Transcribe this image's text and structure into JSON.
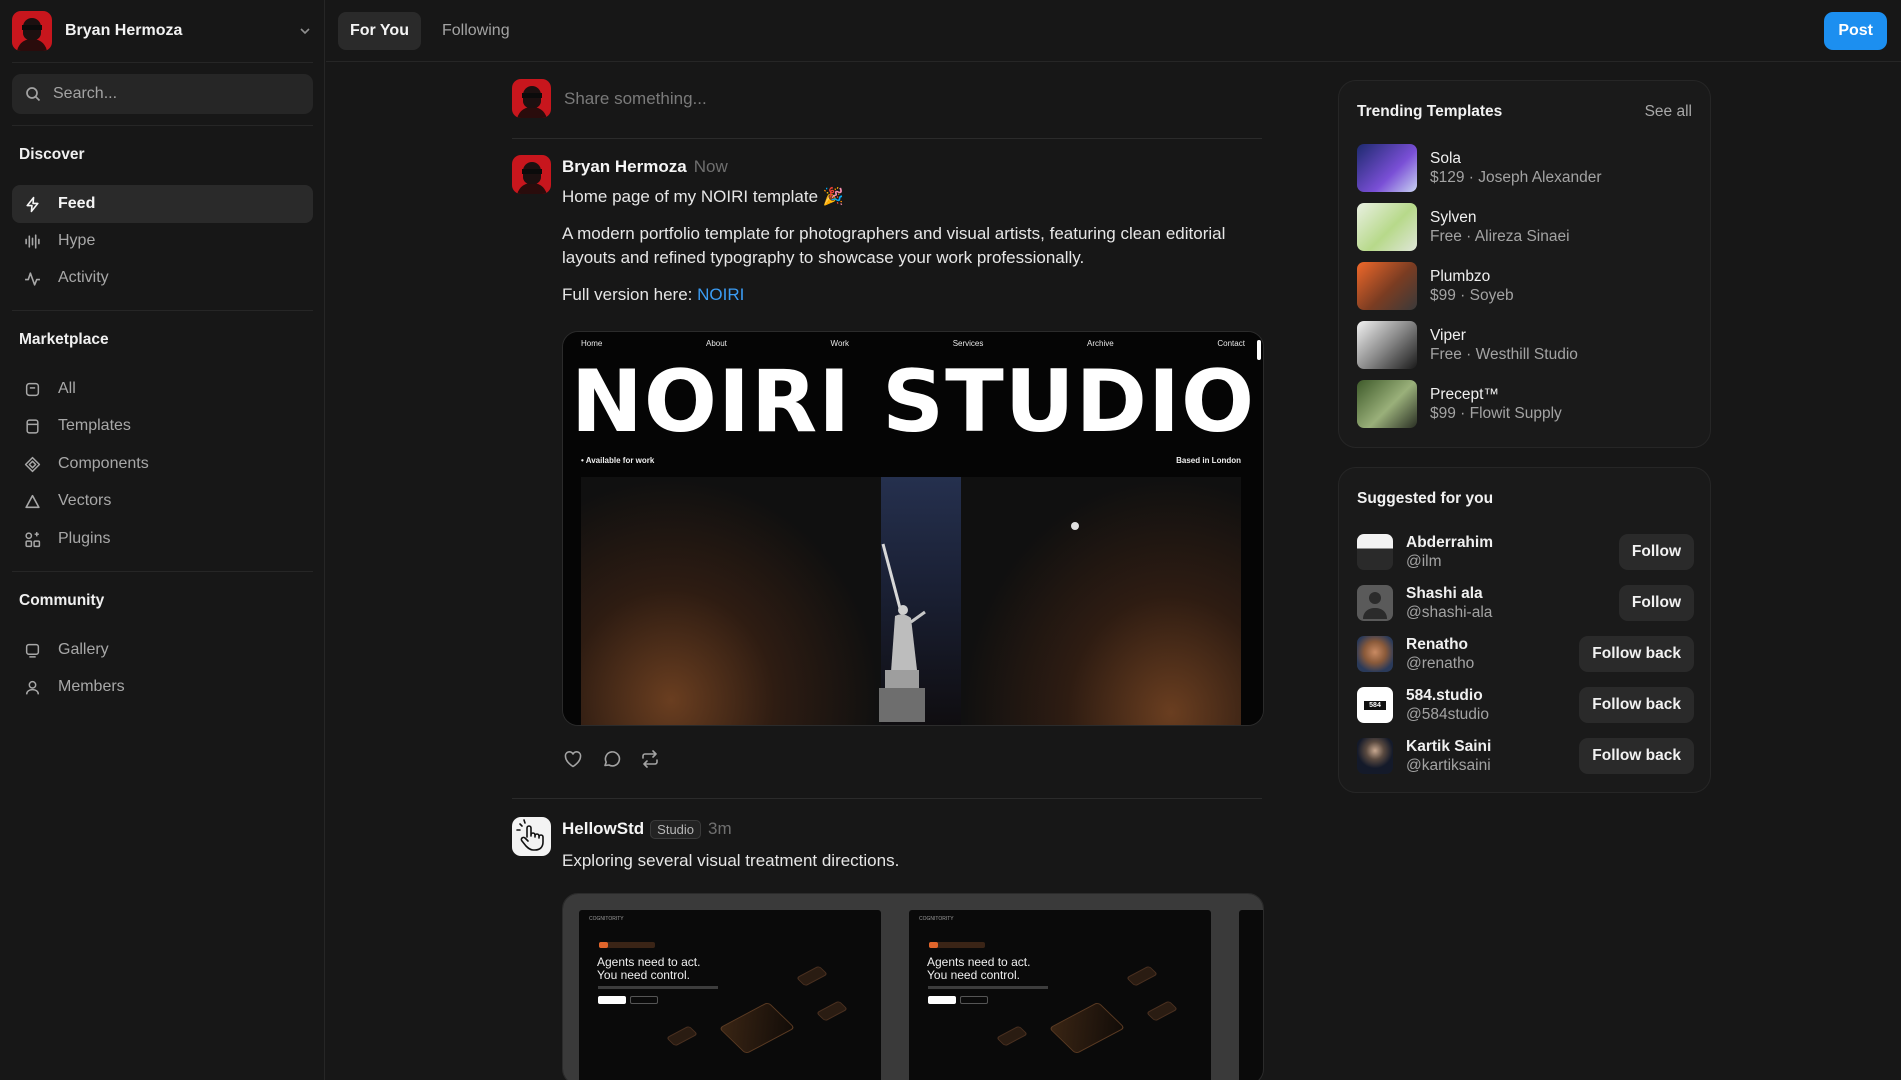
{
  "account": {
    "name": "Bryan Hermoza"
  },
  "search": {
    "placeholder": "Search..."
  },
  "sidebar": {
    "discover_title": "Discover",
    "discover_items": [
      {
        "label": "Feed",
        "icon": "bolt-icon",
        "active": true
      },
      {
        "label": "Hype",
        "icon": "audio-bars-icon"
      },
      {
        "label": "Activity",
        "icon": "pulse-icon"
      }
    ],
    "marketplace_title": "Marketplace",
    "marketplace_items": [
      {
        "label": "All",
        "icon": "box-icon"
      },
      {
        "label": "Templates",
        "icon": "template-icon"
      },
      {
        "label": "Components",
        "icon": "component-icon"
      },
      {
        "label": "Vectors",
        "icon": "triangle-icon"
      },
      {
        "label": "Plugins",
        "icon": "plugin-grid-icon"
      }
    ],
    "community_title": "Community",
    "community_items": [
      {
        "label": "Gallery",
        "icon": "gallery-icon"
      },
      {
        "label": "Members",
        "icon": "user-icon"
      }
    ]
  },
  "topbar": {
    "tabs": [
      {
        "label": "For You",
        "active": true
      },
      {
        "label": "Following"
      }
    ],
    "post_label": "Post"
  },
  "composer": {
    "placeholder": "Share something..."
  },
  "posts": [
    {
      "author": "Bryan Hermoza",
      "time": "Now",
      "title": "Home page of my NOIRI template 🎉",
      "body": "A modern portfolio template for photographers and visual artists, featuring clean editorial layouts and refined typography to showcase your work professionally.",
      "link_prefix": "Full version here: ",
      "link_text": "NOIRI",
      "preview": {
        "nav": [
          "Home",
          "About",
          "Work",
          "Services",
          "Archive",
          "Contact"
        ],
        "title": "NOIRI STUDIO",
        "left_meta": "• Available for work",
        "right_meta": "Based in London"
      }
    },
    {
      "author": "HellowStd",
      "badge": "Studio",
      "time": "3m",
      "body": "Exploring several visual treatment directions.",
      "preview": {
        "brand": "COGNITORITY",
        "headline_1": "Agents need to act.",
        "headline_2": "You need control."
      }
    }
  ],
  "trending": {
    "title": "Trending Templates",
    "see_all": "See all",
    "items": [
      {
        "name": "Sola",
        "meta": "$129 · Joseph Alexander"
      },
      {
        "name": "Sylven",
        "meta": "Free · Alireza Sinaei"
      },
      {
        "name": "Plumbzo",
        "meta": "$99 · Soyeb"
      },
      {
        "name": "Viper",
        "meta": "Free · Westhill Studio"
      },
      {
        "name": "Precept™",
        "meta": "$99 · Flowit Supply"
      }
    ]
  },
  "suggested": {
    "title": "Suggested for you",
    "users": [
      {
        "name": "Abderrahim",
        "handle": "@ilm",
        "action": "Follow"
      },
      {
        "name": "Shashi ala",
        "handle": "@shashi-ala",
        "action": "Follow"
      },
      {
        "name": "Renatho",
        "handle": "@renatho",
        "action": "Follow back"
      },
      {
        "name": "584.studio",
        "handle": "@584studio",
        "action": "Follow back",
        "avatar_text": "584"
      },
      {
        "name": "Kartik Saini",
        "handle": "@kartiksaini",
        "action": "Follow back"
      }
    ]
  },
  "colors": {
    "accent": "#1c8ff0",
    "link": "#3b9cf4",
    "background": "#171717"
  }
}
